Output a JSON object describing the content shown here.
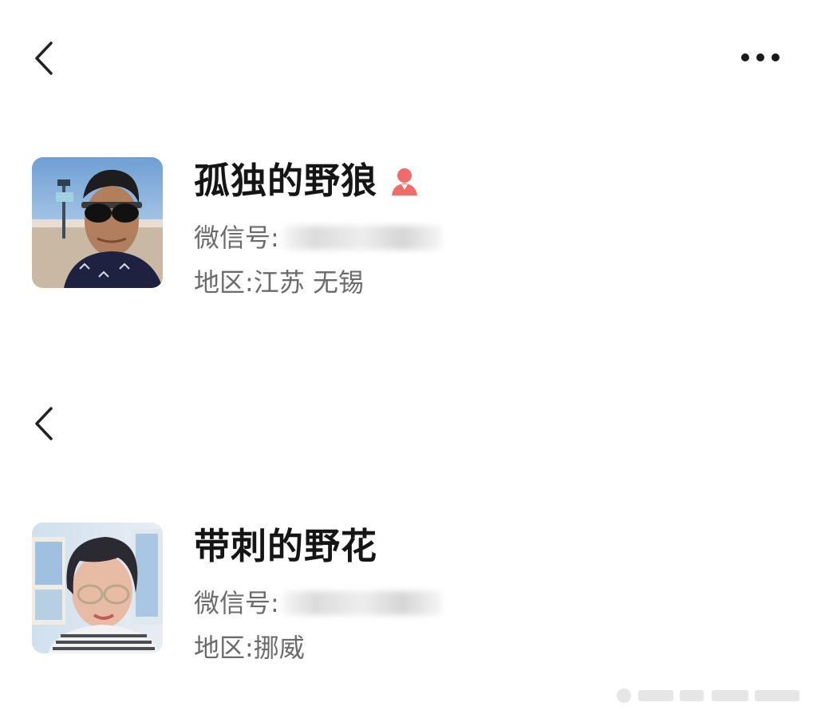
{
  "colors": {
    "background": "#ffffff",
    "name_text": "#151515",
    "info_text": "#6b6b6b",
    "female_icon": "#f26b6b"
  },
  "nav": {
    "back_icon": "chevron-left-icon",
    "more_icon": "more-horizontal-icon"
  },
  "profiles": [
    {
      "name": "孤独的野狼",
      "gender_icon": "female-icon",
      "wechat_id_label": "微信号:",
      "region_label": "地区:",
      "region_value": "江苏 无锡"
    },
    {
      "name": "带刺的野花",
      "wechat_id_label": "微信号:",
      "region_label": "地区:",
      "region_value": "挪威"
    }
  ]
}
